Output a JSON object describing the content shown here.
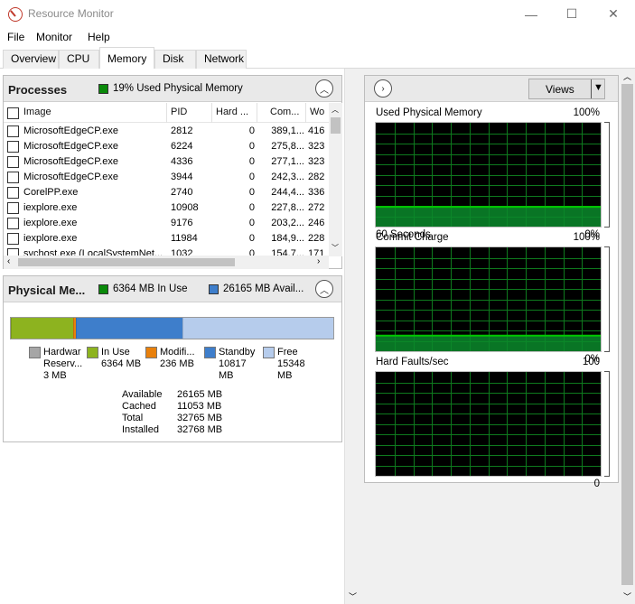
{
  "window": {
    "title": "Resource Monitor",
    "minimize_glyph": "—",
    "maximize_glyph": "☐",
    "close_glyph": "✕"
  },
  "menu": [
    "File",
    "Monitor",
    "Help"
  ],
  "tabs": [
    {
      "label": "Overview",
      "active": false
    },
    {
      "label": "CPU",
      "active": false
    },
    {
      "label": "Memory",
      "active": true
    },
    {
      "label": "Disk",
      "active": false
    },
    {
      "label": "Network",
      "active": false
    }
  ],
  "processes": {
    "title": "Processes",
    "summary": "19% Used Physical Memory",
    "columns": [
      "Image",
      "PID",
      "Hard ...",
      "Com...",
      "Wo"
    ],
    "rows": [
      [
        "MicrosoftEdgeCP.exe",
        "2812",
        "0",
        "389,1...",
        "416"
      ],
      [
        "MicrosoftEdgeCP.exe",
        "6224",
        "0",
        "275,8...",
        "323"
      ],
      [
        "MicrosoftEdgeCP.exe",
        "4336",
        "0",
        "277,1...",
        "323"
      ],
      [
        "MicrosoftEdgeCP.exe",
        "3944",
        "0",
        "242,3...",
        "282"
      ],
      [
        "CorelPP.exe",
        "2740",
        "0",
        "244,4...",
        "336"
      ],
      [
        "iexplore.exe",
        "10908",
        "0",
        "227,8...",
        "272"
      ],
      [
        "iexplore.exe",
        "9176",
        "0",
        "203,2...",
        "246"
      ],
      [
        "iexplore.exe",
        "11984",
        "0",
        "184,9...",
        "228"
      ],
      [
        "svchost.exe (LocalSystemNet...",
        "1032",
        "0",
        "154,7...",
        "171"
      ]
    ]
  },
  "physical_memory": {
    "title": "Physical Me...",
    "in_use_summary": "6364 MB In Use",
    "available_summary": "26165 MB Avail...",
    "bar": {
      "total_mb": 32768,
      "segments": [
        {
          "name": "Hardware Reserved",
          "mb": 3,
          "color": "#808080"
        },
        {
          "name": "In Use",
          "mb": 6364,
          "color": "#8db31f"
        },
        {
          "name": "Modified",
          "mb": 236,
          "color": "#e8800c"
        },
        {
          "name": "Standby",
          "mb": 10817,
          "color": "#3e7ecb"
        },
        {
          "name": "Free",
          "mb": 15348,
          "color": "#b6ccec"
        }
      ]
    },
    "legend": [
      {
        "line1": "Hardwar",
        "line2": "Reserv...",
        "line3": "3 MB",
        "color": "#a6a6a6"
      },
      {
        "line1": "In Use",
        "line2": "6364 MB",
        "line3": "",
        "color": "#8db31f"
      },
      {
        "line1": "Modifi...",
        "line2": "236 MB",
        "line3": "",
        "color": "#e8800c"
      },
      {
        "line1": "Standby",
        "line2": "10817",
        "line3": "MB",
        "color": "#3e7ecb"
      },
      {
        "line1": "Free",
        "line2": "15348",
        "line3": "MB",
        "color": "#b6ccec"
      }
    ],
    "stats": [
      {
        "label": "Available",
        "value": "26165 MB"
      },
      {
        "label": "Cached",
        "value": "11053 MB"
      },
      {
        "label": "Total",
        "value": "32765 MB"
      },
      {
        "label": "Installed",
        "value": "32768 MB"
      }
    ]
  },
  "graphs_panel": {
    "views_label": "Views",
    "graphs": [
      {
        "title": "Used Physical Memory",
        "max_label": "100%",
        "time_label": "60 Seconds",
        "min_label": "0%",
        "level_percent": 19
      },
      {
        "title": "Commit Charge",
        "max_label": "100%",
        "time_label": "",
        "min_label": "0%",
        "level_percent": 15
      },
      {
        "title": "Hard Faults/sec",
        "max_label": "100",
        "time_label": "",
        "min_label": "0",
        "level_percent": 0
      }
    ]
  },
  "colors": {
    "graph_line": "#00c800",
    "graph_fill": "#0b8a2c",
    "graph_grid": "#0e7a1e",
    "in_use_green": "#0a8a0a",
    "available_blue": "#3e7ecb"
  }
}
